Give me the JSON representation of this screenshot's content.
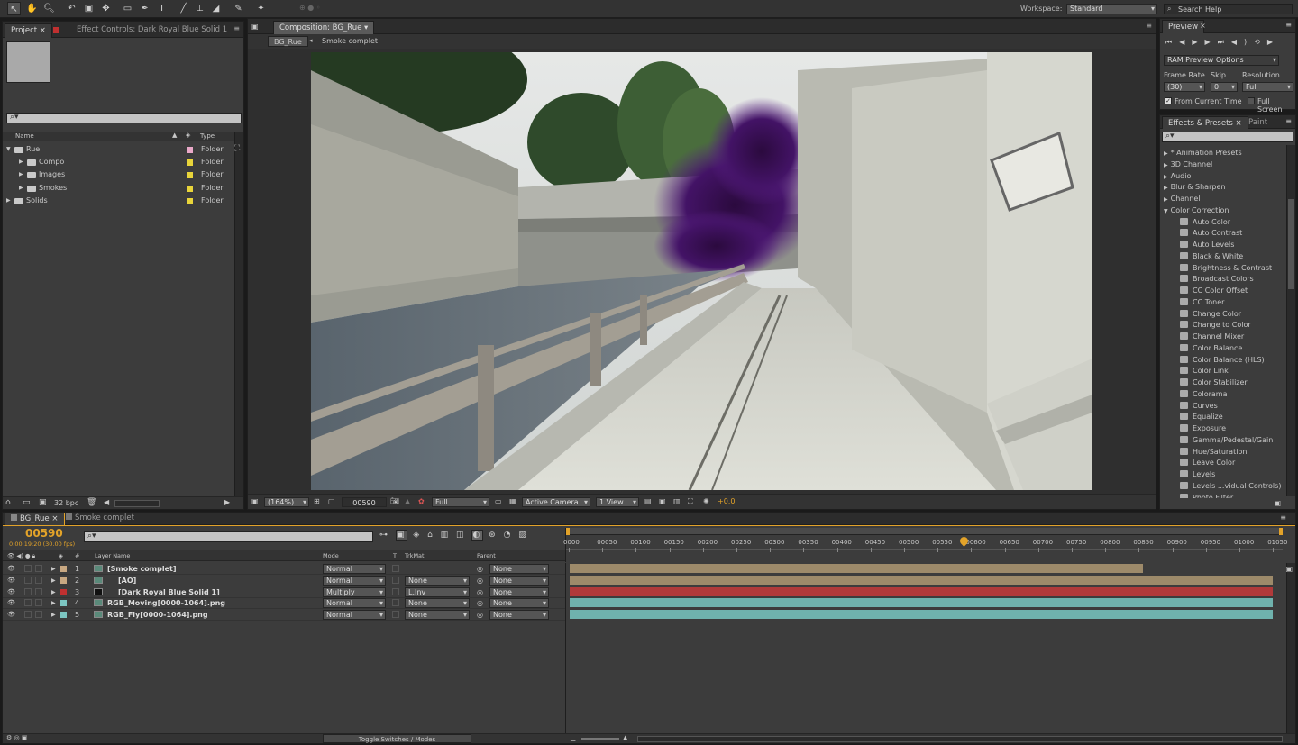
{
  "toolbar": {
    "tools": [
      "selection-tool",
      "hand-tool",
      "zoom-tool",
      "rotate-tool",
      "camera-tool",
      "pan-behind-tool",
      "rectangle-tool",
      "pen-tool",
      "type-tool",
      "brush-tool",
      "clone-stamp-tool",
      "eraser-tool",
      "roto-brush-tool",
      "puppet-tool"
    ],
    "workspace_label": "Workspace:",
    "workspace_value": "Standard",
    "search_placeholder": "Search Help"
  },
  "project": {
    "tab_project": "Project",
    "tab_effect_controls": "Effect Controls: Dark Royal Blue Solid 1",
    "col_name": "Name",
    "col_type": "Type",
    "items": [
      {
        "name": "Rue",
        "type": "Folder",
        "color": "#e9a8c8",
        "level": 0,
        "open": true
      },
      {
        "name": "Compo",
        "type": "Folder",
        "color": "#e8d43a",
        "level": 1,
        "open": false
      },
      {
        "name": "Images",
        "type": "Folder",
        "color": "#e8d43a",
        "level": 1,
        "open": false
      },
      {
        "name": "Smokes",
        "type": "Folder",
        "color": "#e8d43a",
        "level": 1,
        "open": false
      },
      {
        "name": "Solids",
        "type": "Folder",
        "color": "#e8d43a",
        "level": 0,
        "open": false
      }
    ],
    "bpc": "32 bpc"
  },
  "composition": {
    "tab": "Composition: BG_Rue",
    "crumb_active": "BG_Rue",
    "crumb_next": "Smoke complet",
    "zoom": "(164%)",
    "frame": "00590",
    "resolution": "Full",
    "camera": "Active Camera",
    "views": "1 View",
    "exposure": "+0,0"
  },
  "preview": {
    "tab": "Preview",
    "ram_options": "RAM Preview Options",
    "frame_rate_label": "Frame Rate",
    "skip_label": "Skip",
    "resolution_label": "Resolution",
    "frame_rate": "(30)",
    "skip": "0",
    "resolution": "Full",
    "from_current": "From Current Time",
    "full_screen": "Full Screen"
  },
  "effects": {
    "tab_effects": "Effects & Presets",
    "tab_paint": "Paint",
    "categories": [
      "* Animation Presets",
      "3D Channel",
      "Audio",
      "Blur & Sharpen",
      "Channel"
    ],
    "open_category": "Color Correction",
    "items": [
      "Auto Color",
      "Auto Contrast",
      "Auto Levels",
      "Black & White",
      "Brightness & Contrast",
      "Broadcast Colors",
      "CC Color Offset",
      "CC Toner",
      "Change Color",
      "Change to Color",
      "Channel Mixer",
      "Color Balance",
      "Color Balance (HLS)",
      "Color Link",
      "Color Stabilizer",
      "Colorama",
      "Curves",
      "Equalize",
      "Exposure",
      "Gamma/Pedestal/Gain",
      "Hue/Saturation",
      "Leave Color",
      "Levels",
      "Levels ...vidual Controls)",
      "Photo Filter"
    ]
  },
  "timeline": {
    "tab_active": "BG_Rue",
    "tab_other": "Smoke complet",
    "timecode": "00590",
    "timecode_sub": "0:00:19:20 (30.00 fps)",
    "col_layer_name": "Layer Name",
    "col_mode": "Mode",
    "col_t": "T",
    "col_trkmat": "TrkMat",
    "col_parent": "Parent",
    "layers": [
      {
        "num": "1",
        "name": "[Smoke complet]",
        "mode": "Normal",
        "trkmat": "",
        "parent": "None",
        "label": "#c8a882",
        "bar": "#9d8a6a",
        "end": 0.815
      },
      {
        "num": "2",
        "name": "[AO]",
        "mode": "Normal",
        "trkmat": "None",
        "parent": "None",
        "label": "#c8a882",
        "bar": "#9d8a6a",
        "end": 1.0
      },
      {
        "num": "3",
        "name": "[Dark Royal Blue Solid 1]",
        "mode": "Multiply",
        "trkmat": "L.Inv",
        "parent": "None",
        "label": "#c03030",
        "bar": "#b03a3a",
        "end": 1.0
      },
      {
        "num": "4",
        "name": "RGB_Moving[0000-1064].png",
        "mode": "Normal",
        "trkmat": "None",
        "parent": "None",
        "label": "#7cc6c2",
        "bar": "#6fb2ad",
        "end": 1.0
      },
      {
        "num": "5",
        "name": "RGB_Fly[0000-1064].png",
        "mode": "Normal",
        "trkmat": "None",
        "parent": "None",
        "label": "#7cc6c2",
        "bar": "#6fb2ad",
        "end": 1.0
      }
    ],
    "ruler": [
      "0000",
      "00050",
      "00100",
      "00150",
      "00200",
      "00250",
      "00300",
      "00350",
      "00400",
      "00450",
      "00500",
      "00550",
      "00600",
      "00650",
      "00700",
      "00750",
      "00800",
      "00850",
      "00900",
      "00950",
      "01000",
      "01050"
    ],
    "current_frame": 590,
    "toggle_label": "Toggle Switches / Modes"
  }
}
